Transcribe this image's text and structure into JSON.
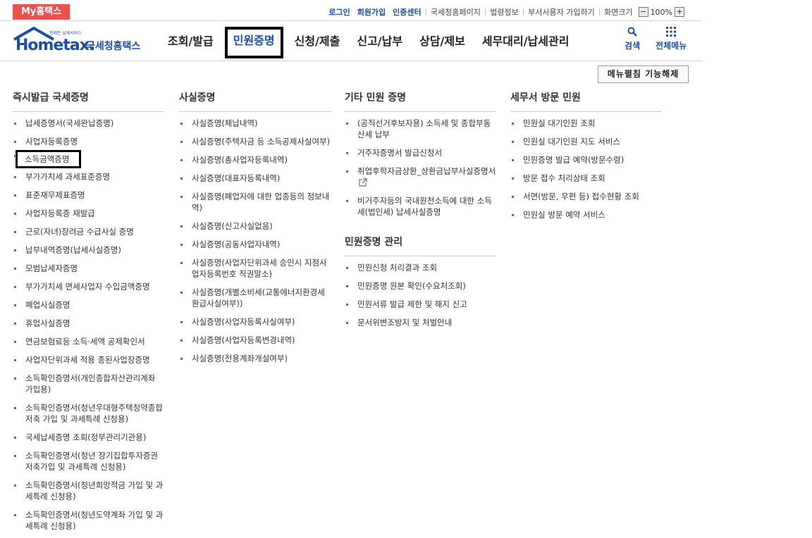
{
  "topbar": {
    "my_tab": "My홈택스",
    "links": [
      "로그인",
      "회원가입",
      "인증센터",
      "국세청홈페이지",
      "법령정보",
      "부서사용자 가입하기"
    ],
    "screen_size_label": "화면크기",
    "zoom_minus": "−",
    "zoom_value": "100%",
    "zoom_plus": "+"
  },
  "header": {
    "logo_word": "Hometax.",
    "logo_small": "언제든 납세서비스",
    "logo_kor": "국세청홈택스",
    "nav": [
      "조회/발급",
      "민원증명",
      "신청/제출",
      "신고/납부",
      "상담/제보",
      "세무대리/납세관리"
    ],
    "active_nav": "민원증명",
    "search_label": "검색",
    "allmenu_label": "전체메뉴"
  },
  "menu_toggle": "메뉴펼침 기능해제",
  "columns": {
    "instant": {
      "title": "즉시발급 국세증명",
      "items": [
        "납세증명서(국세완납증명)",
        "사업자등록증명",
        "소득금액증명",
        "부가가치세 과세표준증명",
        "표준재무제표증명",
        "사업자등록증 재발급",
        "근로(자녀)장려금 수급사실 증명",
        "납부내역증명(납세사실증명)",
        "모범납세자증명",
        "부가가치세 면세사업자 수입금액증명",
        "폐업사실증명",
        "휴업사실증명",
        "연금보험료등 소득·세액 공제확인서",
        "사업자단위과세 적용 종된사업장증명",
        "소득확인증명서(개인종합자산관리계좌 가입용)",
        "소득확인증명서(청년우대형주택청약종합저축 가입 및 과세특례 신청용)",
        "국세납세증명 조회(정부관리기관용)",
        "소득확인증명서(청년 장기집합투자증권저축가입 및 과세특례 신청용)",
        "소득확인증명서(청년희망적금 가입 및 과세특례 신청용)",
        "소득확인증명서(청년도약계좌 가입 및 과세특례 신청용)"
      ]
    },
    "fact": {
      "title": "사실증명",
      "items": [
        "사실증명(체납내역)",
        "사실증명(주택자금 등 소득공제사실여부)",
        "사실증명(총사업자등록내역)",
        "사실증명(대표자등록내역)",
        "사실증명(폐업자에 대한 업종등의 정보내역)",
        "사실증명(신고사실없음)",
        "사실증명(공동사업자내역)",
        "사실증명(사업자단위과세 승인시 지점사업자등록번호 직권말소)",
        "사실증명(개별소비세(교통에너지환경세 환급사실여부))",
        "사실증명(사업자등록사실여부)",
        "사실증명(사업자등록변경내역)",
        "사실증명(전용계좌개설여부)"
      ]
    },
    "other": {
      "title": "기타 민원 증명",
      "items": [
        "(공직선거후보자용) 소득세 및 종합부동산세 납부",
        "거주자증명서 발급신청서",
        "취업후학자금상환_상환금납부사실증명서",
        "비거주자등의 국내원천소득에 대한 소득세(법인세) 납세사실증명"
      ]
    },
    "manage": {
      "title": "민원증명 관리",
      "items": [
        "민원신청 처리결과 조회",
        "민원증명 원본 확인(수요처조회)",
        "민원서류 발급 제한 및 해지 신고",
        "문서위변조방지 및 처벌안내"
      ]
    },
    "visit": {
      "title": "세무서 방문 민원",
      "items": [
        "민원실 대기인원 조회",
        "민원실 대기인원 지도 서비스",
        "민원증명 발급 예약(방문수령)",
        "방문 접수 처리상태 조회",
        "서면(방문, 우편 등) 접수현황 조회",
        "민원실 방문 예약 서비스"
      ]
    }
  },
  "colors": {
    "brand": "#1d4fa3",
    "my_tab": "#e8524f"
  }
}
